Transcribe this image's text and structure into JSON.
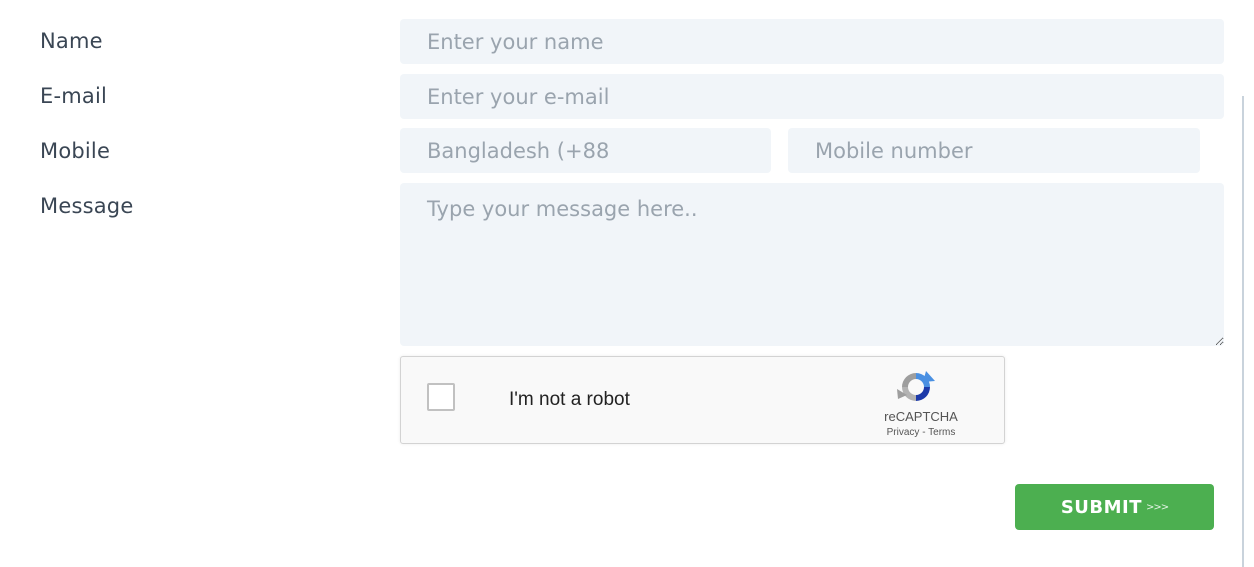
{
  "form": {
    "name_label": "Name",
    "email_label": "E-mail",
    "mobile_label": "Mobile",
    "message_label": "Message",
    "name_placeholder": "Enter your name",
    "email_placeholder": "Enter your e-mail",
    "country_placeholder": "Bangladesh (+88",
    "mobile_placeholder": "Mobile number",
    "message_placeholder": "Type your message here.."
  },
  "captcha": {
    "label": "I'm not a robot",
    "brand": "reCAPTCHA",
    "privacy": "Privacy",
    "separator": " - ",
    "terms": "Terms"
  },
  "submit": {
    "label": "SUBMIT",
    "arrows": ">>>"
  },
  "colors": {
    "field_bg": "#f1f5f9",
    "submit_bg": "#4caf50",
    "label_text": "#3a4654"
  }
}
